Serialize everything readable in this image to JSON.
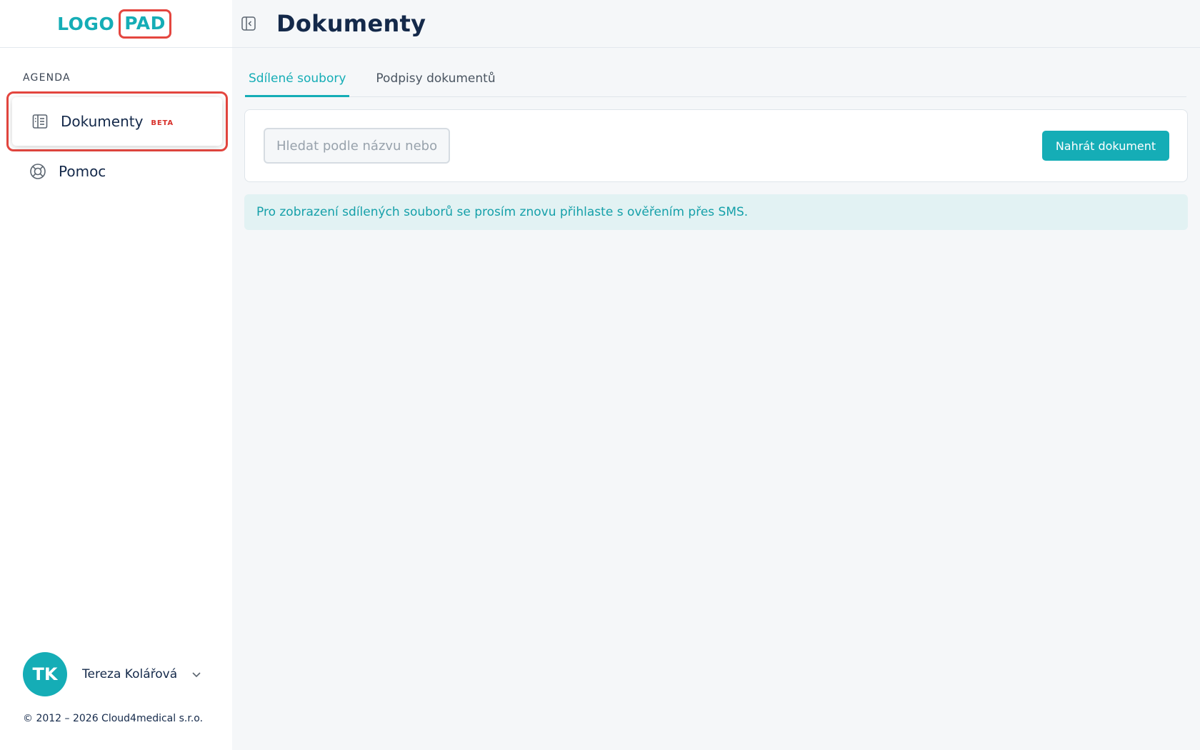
{
  "brand": {
    "logo_left": "LOGO",
    "logo_right": "PAD",
    "accent_color": "#15adb6",
    "highlight_color": "#e4463f"
  },
  "sidebar": {
    "section_label": "AGENDA",
    "items": [
      {
        "label": "Dokumenty",
        "badge": "BETA",
        "icon": "document-list-icon",
        "highlighted": true
      },
      {
        "label": "Pomoc",
        "icon": "lifebuoy-icon"
      }
    ],
    "user": {
      "initials": "TK",
      "name": "Tereza Kolářová"
    },
    "copyright": "© 2012 – 2026 Cloud4medical s.r.o."
  },
  "header": {
    "title": "Dokumenty",
    "collapse_icon": "sidebar-collapse-icon"
  },
  "tabs": [
    {
      "label": "Sdílené soubory",
      "active": true
    },
    {
      "label": "Podpisy dokumentů",
      "active": false
    }
  ],
  "toolbar": {
    "search_placeholder": "Hledat podle názvu nebo",
    "upload_label": "Nahrát dokument"
  },
  "info_message": "Pro zobrazení sdílených souborů se prosím znovu přihlaste s ověřením přes SMS."
}
